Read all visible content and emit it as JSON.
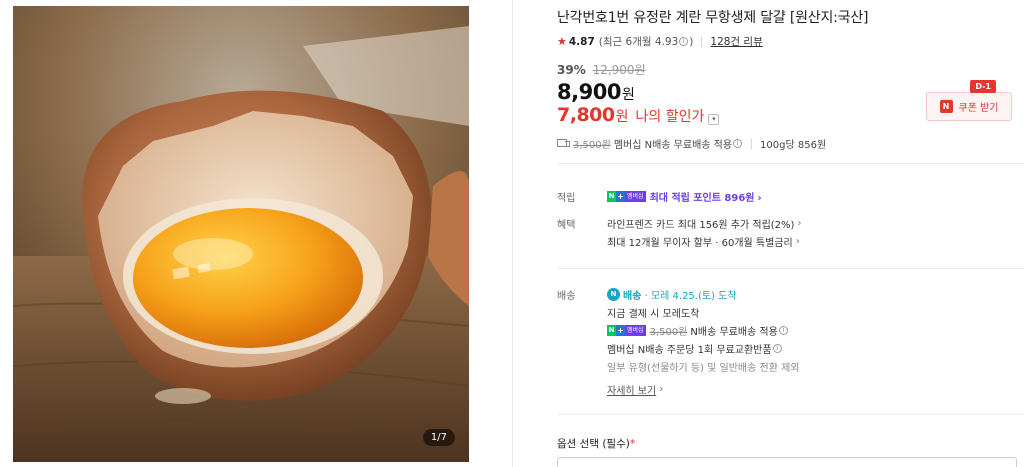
{
  "image": {
    "counter": "1/7"
  },
  "product": {
    "title": "난각번호1번 유정란 계란 무항생제 달걀 [원산지:국산]",
    "rating": "4.87",
    "rating_sub": "(최근 6개월 4.93",
    "rating_close": ")",
    "review_count": "128건 리뷰",
    "discount_rate": "39%",
    "original_price": "12,900원",
    "price": "8,900",
    "currency": "원",
    "sale_price": "7,800",
    "sale_label": "나의 할인가",
    "shipping_strike": "3,500원",
    "shipping_text": "멤버십 N배송 무료배송 적용",
    "unit_price": "100g당 856원"
  },
  "coupon": {
    "dday": "D-1",
    "label": "쿠폰 받기",
    "badge": "N"
  },
  "points": {
    "label": "적립",
    "badge_n": "N",
    "badge_plus": "+",
    "badge_member": "멤버십",
    "text": "최대 적립 포인트 896원"
  },
  "benefits": {
    "label": "혜택",
    "line1": "라인프렌즈 카드 최대 156원 추가 적립(2%)",
    "line2": "최대 12개월 무이자 할부 · 60개월 특별금리"
  },
  "delivery": {
    "label": "배송",
    "icon": "N",
    "brand": "배송",
    "date": "· 모레 4.25.(토) 도착",
    "line2": "지금 결제 시 모레도착",
    "line3_strike": "3,500원",
    "line3_text": "N배송 무료배송 적용",
    "line4": "멤버십 N배송 주문당 1회 무료교환반품",
    "line5": "일부 유형(선물하기 등) 및 일반배송 전환 제외",
    "more": "자세히 보기"
  },
  "option": {
    "label": "옵션 선택 (필수)",
    "required_mark": "*"
  },
  "icons": {
    "star": "star-icon",
    "info": "info-icon",
    "truck": "truck-icon",
    "chevron": "chevron-right-icon",
    "dropdown": "chevron-down-icon"
  },
  "colors": {
    "accent": "#e5362e",
    "point": "#6d3ee8",
    "delivery": "#16a5c2"
  }
}
